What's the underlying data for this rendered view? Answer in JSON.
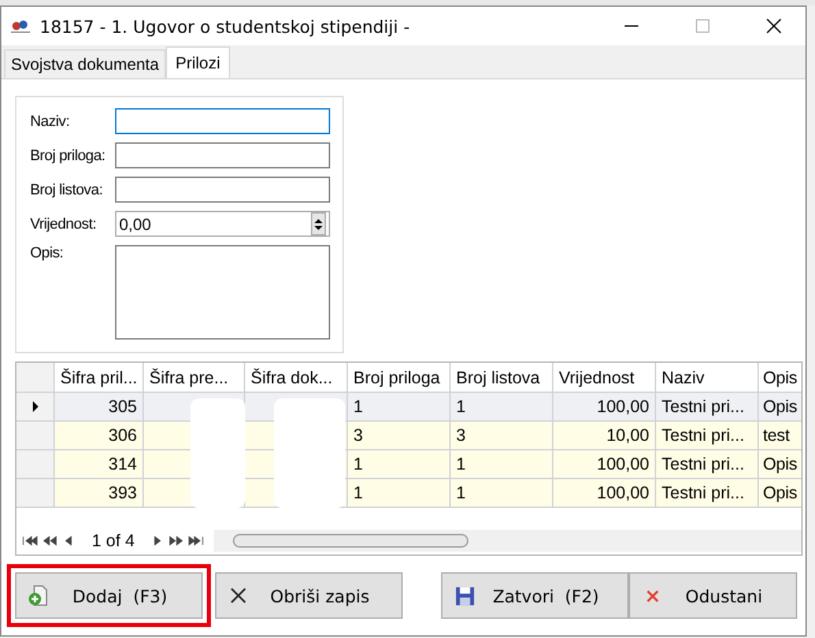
{
  "window": {
    "title": "18157 - 1. Ugovor o studentskoj stipendiji -"
  },
  "tabs": [
    {
      "label": "Svojstva dokumenta",
      "selected": false
    },
    {
      "label": "Prilozi",
      "selected": true
    }
  ],
  "form": {
    "fields": [
      {
        "kind": "text",
        "label": "Naziv:",
        "focused": true
      },
      {
        "kind": "text",
        "label": "Broj priloga:",
        "focused": false
      },
      {
        "kind": "text",
        "label": "Broj listova:",
        "focused": false
      },
      {
        "kind": "spin",
        "label": "Vrijednost:",
        "value": "0,00",
        "focused": false
      },
      {
        "kind": "memo",
        "label": "Opis:",
        "focused": false
      }
    ]
  },
  "table": {
    "columns": [
      "Šifra pril...",
      "Šifra pre...",
      "Šifra dok...",
      "Broj priloga",
      "Broj listova",
      "Vrijednost",
      "Naziv",
      "Opis"
    ],
    "rows": [
      {
        "selected": true,
        "cells": [
          "305",
          "",
          "",
          "1",
          "1",
          "100,00",
          "Testni pri...",
          "Opis"
        ]
      },
      {
        "selected": false,
        "cells": [
          "306",
          "",
          "",
          "3",
          "3",
          "10,00",
          "Testni pri...",
          "test"
        ]
      },
      {
        "selected": false,
        "cells": [
          "314",
          "",
          "",
          "1",
          "1",
          "100,00",
          "Testni pri...",
          "Opis"
        ]
      },
      {
        "selected": false,
        "cells": [
          "393",
          "",
          "",
          "1",
          "1",
          "100,00",
          "Testni pri...",
          "Opis"
        ]
      }
    ],
    "pager": "1 of 4"
  },
  "buttons": [
    {
      "kind": "add",
      "label": "Dodaj  (F3)",
      "highlighted": true
    },
    {
      "kind": "delete",
      "label": "Obriši zapis",
      "highlighted": false
    },
    {
      "kind": "save",
      "label": "Zatvori  (F2)",
      "highlighted": false
    },
    {
      "kind": "cancel",
      "label": "Odustani",
      "highlighted": false
    }
  ]
}
